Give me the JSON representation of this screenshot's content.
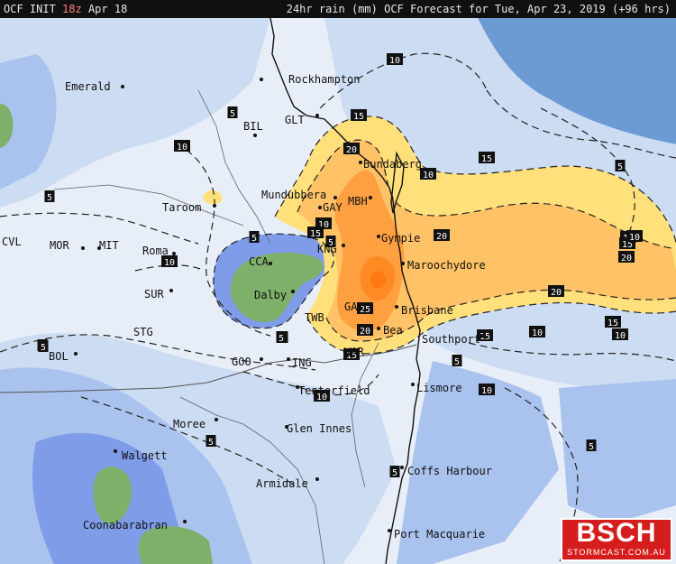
{
  "header": {
    "model": "OCF INIT",
    "init_hour": "18z",
    "init_date": "Apr 18",
    "title": "24hr rain (mm) OCF Forecast for Tue, Apr 23, 2019 (+96 hrs)"
  },
  "logo": {
    "name": "BSCH",
    "site": "STORMCAST.COM.AU"
  },
  "towns": [
    {
      "label": "Rockhampton"
    },
    {
      "label": "Emerald"
    },
    {
      "label": "BIL"
    },
    {
      "label": "GLT"
    },
    {
      "label": "Bundaberg"
    },
    {
      "label": "Mundubbera"
    },
    {
      "label": "MBH"
    },
    {
      "label": "GAY"
    },
    {
      "label": "Taroom"
    },
    {
      "label": "Gympie"
    },
    {
      "label": "KNG"
    },
    {
      "label": "Roma"
    },
    {
      "label": "CVL"
    },
    {
      "label": "MOR"
    },
    {
      "label": "MIT"
    },
    {
      "label": "CCA"
    },
    {
      "label": "Dalby"
    },
    {
      "label": "Maroochydore"
    },
    {
      "label": "SUR"
    },
    {
      "label": "Brisbane"
    },
    {
      "label": "GAT"
    },
    {
      "label": "TWB"
    },
    {
      "label": "Bea"
    },
    {
      "label": "Southport"
    },
    {
      "label": "STG"
    },
    {
      "label": "BOL"
    },
    {
      "label": "GOO"
    },
    {
      "label": "ING"
    },
    {
      "label": "WAR"
    },
    {
      "label": "Tenterfield"
    },
    {
      "label": "Lismore"
    },
    {
      "label": "Moree"
    },
    {
      "label": "Glen Innes"
    },
    {
      "label": "Walgett"
    },
    {
      "label": "Coffs Harbour"
    },
    {
      "label": "Armidale"
    },
    {
      "label": "Coonabarabran"
    },
    {
      "label": "Port Macquarie"
    }
  ],
  "contour_labels": [
    "10",
    "5",
    "15",
    "10",
    "20",
    "10",
    "15",
    "5",
    "5",
    "5",
    "10",
    "15",
    "10",
    "5",
    "20",
    "10",
    "15",
    "10",
    "15",
    "20",
    "20",
    "10",
    "15",
    "10",
    "20",
    "25",
    "5",
    "20",
    "5",
    "15",
    "5",
    "10",
    "10",
    "5",
    "5",
    "5",
    "5",
    "5"
  ],
  "colors": {
    "ocean": "#6c9bd4",
    "land_dry": "#e8eef8",
    "light_rain": "#ccdcf2",
    "rain_5": "#a9c2ee",
    "rain_10": "#7f9ce8",
    "rain_15": "#ffe07a",
    "rain_20": "#ffc266",
    "rain_25": "#ffa040",
    "rain_30": "#ff8a24",
    "green_patch": "#7fb06a"
  }
}
